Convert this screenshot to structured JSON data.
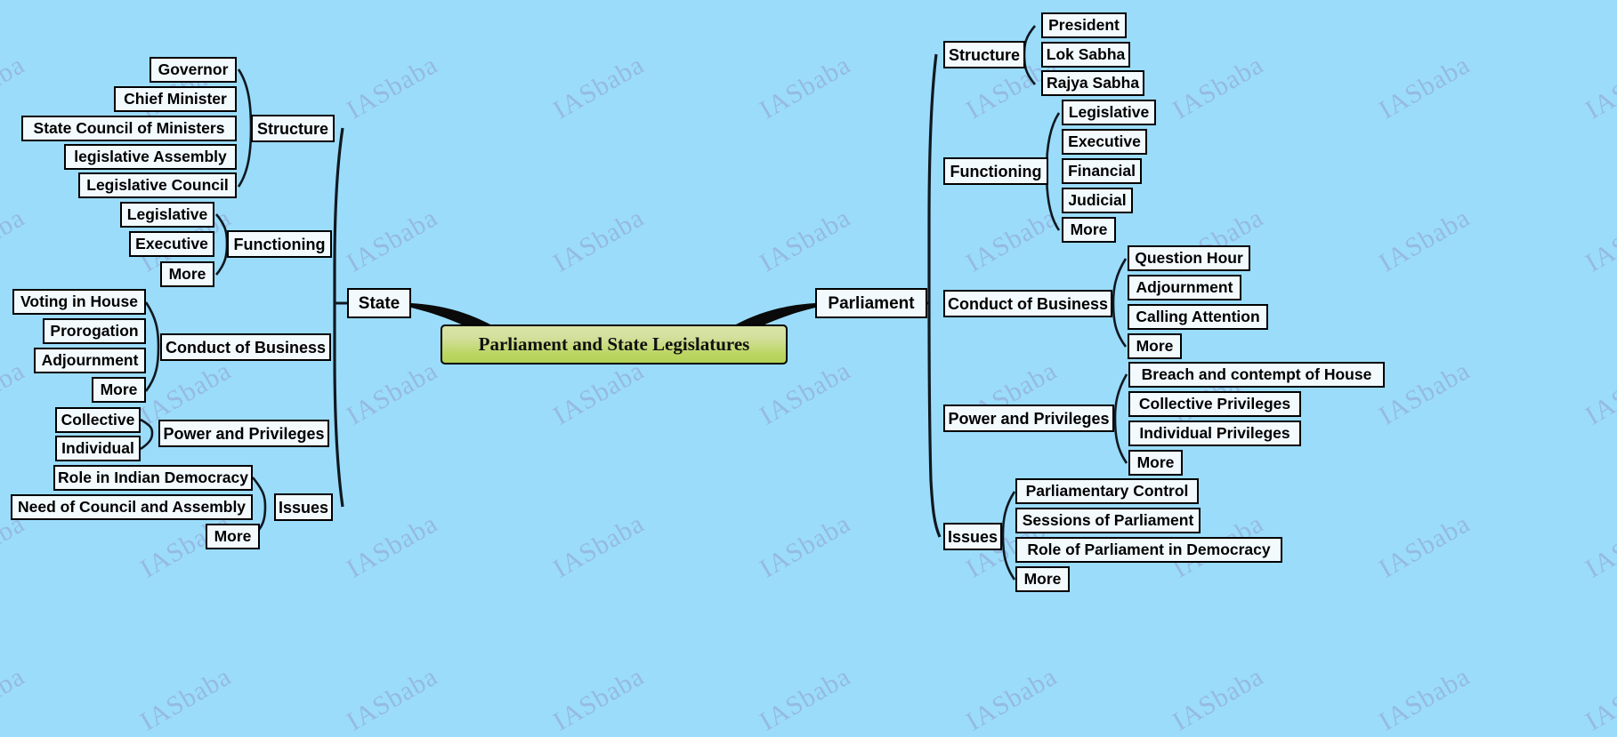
{
  "diagram": {
    "type": "mind-map",
    "title": "Parliament and State Legislatures",
    "background_color": "#9bdcfa",
    "central_node_color": "#bcd663",
    "node_fill": "#f3fafe",
    "node_border": "#000000",
    "watermark_text": "IASbaba",
    "watermark_color": "#8a6fb0"
  },
  "central": {
    "label": "Parliament and State Legislatures"
  },
  "left": {
    "main": {
      "label": "State"
    },
    "branches": [
      {
        "label": "Structure",
        "children": [
          {
            "label": "Governor"
          },
          {
            "label": "Chief Minister"
          },
          {
            "label": "State Council of Ministers"
          },
          {
            "label": "legislative Assembly"
          },
          {
            "label": "Legislative Council"
          }
        ]
      },
      {
        "label": "Functioning",
        "children": [
          {
            "label": "Legislative"
          },
          {
            "label": "Executive"
          },
          {
            "label": "More"
          }
        ]
      },
      {
        "label": "Conduct of Business",
        "children": [
          {
            "label": "Voting in House"
          },
          {
            "label": "Prorogation"
          },
          {
            "label": "Adjournment"
          },
          {
            "label": "More"
          }
        ]
      },
      {
        "label": "Power and Privileges",
        "children": [
          {
            "label": "Collective"
          },
          {
            "label": "Individual"
          }
        ]
      },
      {
        "label": "Issues",
        "children": [
          {
            "label": "Role in Indian Democracy"
          },
          {
            "label": "Need of Council and Assembly"
          },
          {
            "label": "More"
          }
        ]
      }
    ]
  },
  "right": {
    "main": {
      "label": "Parliament"
    },
    "branches": [
      {
        "label": "Structure",
        "children": [
          {
            "label": "President"
          },
          {
            "label": "Lok Sabha"
          },
          {
            "label": "Rajya Sabha"
          }
        ]
      },
      {
        "label": "Functioning",
        "children": [
          {
            "label": "Legislative"
          },
          {
            "label": "Executive"
          },
          {
            "label": "Financial"
          },
          {
            "label": "Judicial"
          },
          {
            "label": "More"
          }
        ]
      },
      {
        "label": "Conduct of Business",
        "children": [
          {
            "label": "Question Hour"
          },
          {
            "label": "Adjournment"
          },
          {
            "label": "Calling Attention"
          },
          {
            "label": "More"
          }
        ]
      },
      {
        "label": "Power and Privileges",
        "children": [
          {
            "label": "Breach and contempt of House"
          },
          {
            "label": "Collective Privileges"
          },
          {
            "label": "Individual Privileges"
          },
          {
            "label": "More"
          }
        ]
      },
      {
        "label": "Issues",
        "children": [
          {
            "label": "Parliamentary Control"
          },
          {
            "label": "Sessions of Parliament"
          },
          {
            "label": "Role of Parliament in Democracy"
          },
          {
            "label": "More"
          }
        ]
      }
    ]
  }
}
